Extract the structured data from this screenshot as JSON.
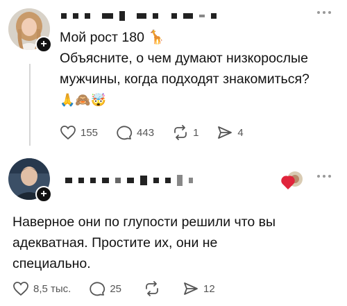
{
  "post1": {
    "username_redacted": true,
    "line1": "Мой рост 180 🦒",
    "line2": "Объясните, о чем думают низкорослые",
    "line3": "мужчины, когда подходят знакомиться?",
    "emojis": "🙏🙈🤯",
    "actions": {
      "likes": "155",
      "comments": "443",
      "reposts": "1",
      "shares": "4"
    }
  },
  "post2": {
    "username_redacted": true,
    "line1": "Наверное они по глупости решили что вы",
    "line2": "адекватная. Простите их, они не",
    "line3": "специально.",
    "actions": {
      "likes": "8,5 тыс.",
      "comments": "25",
      "shares": "12"
    }
  },
  "icons": {
    "follow": "plus-icon",
    "more": "more-icon",
    "like": "heart-icon",
    "comment": "comment-icon",
    "repost": "repost-icon",
    "share": "send-icon"
  },
  "colors": {
    "heart_badge": "#e0243b",
    "action_gray": "#555555",
    "thread_line": "#d6d6d6"
  }
}
